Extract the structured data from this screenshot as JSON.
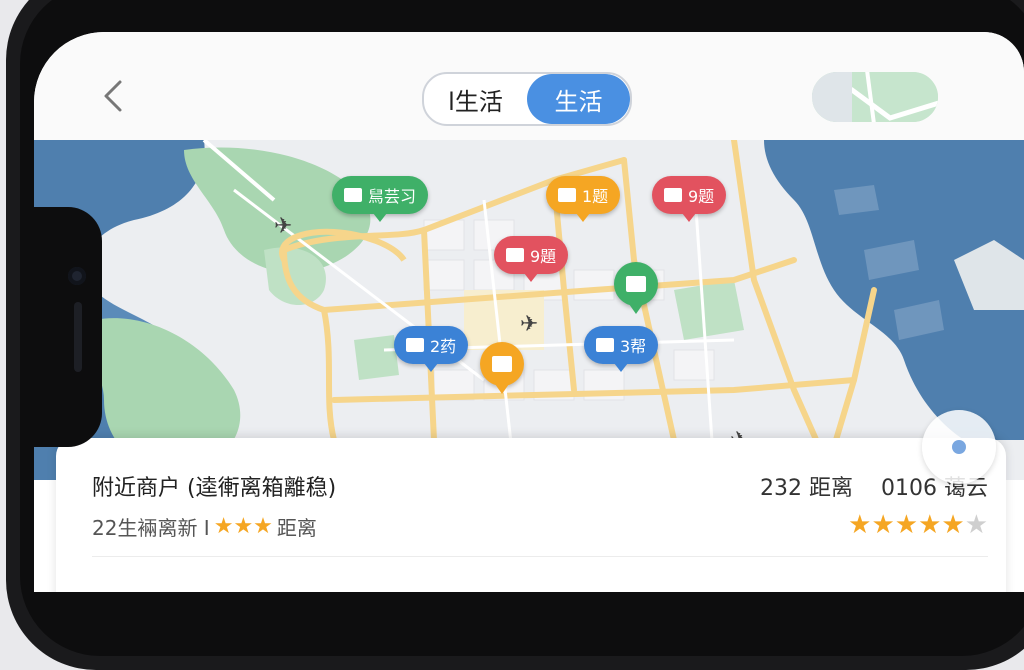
{
  "nav": {
    "tabs": [
      {
        "label": "l生活"
      },
      {
        "label": "生活"
      }
    ]
  },
  "map": {
    "pins": [
      {
        "label": "舃芸习",
        "color": "#3fb068",
        "icon": "ticket-icon"
      },
      {
        "label": "1题",
        "color": "#f5a623",
        "icon": "mail-icon"
      },
      {
        "label": "9题",
        "color": "#e2525f",
        "icon": "gift-icon"
      },
      {
        "label": "9題",
        "color": "#e2525f",
        "icon": "gift-icon"
      },
      {
        "label": "",
        "color": "#3fb068",
        "icon": "mail-icon"
      },
      {
        "label": "2药",
        "color": "#3b82d6",
        "icon": "gift-icon"
      },
      {
        "label": "",
        "color": "#f5a623",
        "icon": "mail-icon"
      },
      {
        "label": "3帮",
        "color": "#3b82d6",
        "icon": "stack-icon"
      }
    ]
  },
  "panel": {
    "title": "附近商户 (逵䡓离箱離稳)",
    "distance": "232 距离",
    "weather": "0106 蔼云",
    "subtitle": "22生裲离新 I",
    "subtitle_stars": "★★★",
    "subtitle_suffix": "距离",
    "rating_full": "★★★★★",
    "rating_empty": "★"
  },
  "colors": {
    "accent": "#4a90e2",
    "star": "#f5a623",
    "water": "#4f7fae",
    "park": "#a9d6b1",
    "road": "#f7d58a"
  }
}
